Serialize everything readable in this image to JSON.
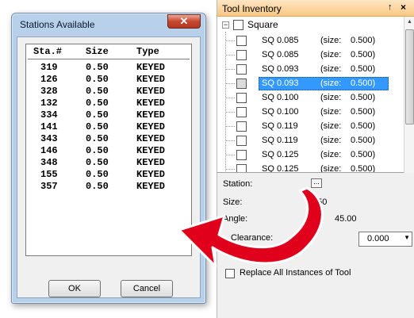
{
  "dialog": {
    "title": "Stations Available",
    "close_glyph": "✕",
    "columns": [
      "Sta.#",
      "Size",
      "Type"
    ],
    "rows": [
      {
        "station": "319",
        "size": "0.50",
        "type": "KEYED"
      },
      {
        "station": "126",
        "size": "0.50",
        "type": "KEYED"
      },
      {
        "station": "328",
        "size": "0.50",
        "type": "KEYED"
      },
      {
        "station": "132",
        "size": "0.50",
        "type": "KEYED"
      },
      {
        "station": "334",
        "size": "0.50",
        "type": "KEYED"
      },
      {
        "station": "141",
        "size": "0.50",
        "type": "KEYED"
      },
      {
        "station": "343",
        "size": "0.50",
        "type": "KEYED"
      },
      {
        "station": "146",
        "size": "0.50",
        "type": "KEYED"
      },
      {
        "station": "348",
        "size": "0.50",
        "type": "KEYED"
      },
      {
        "station": "155",
        "size": "0.50",
        "type": "KEYED"
      },
      {
        "station": "357",
        "size": "0.50",
        "type": "KEYED"
      }
    ],
    "ok_label": "OK",
    "cancel_label": "Cancel"
  },
  "panel": {
    "title": "Tool Inventory",
    "pin_glyph": "↑",
    "close_glyph": "×",
    "tree": {
      "expander_glyph": "−",
      "root_label": "Square",
      "tools": [
        {
          "name": "SQ 0.085",
          "size_label": "(size:",
          "size": "0.500)",
          "selected": false
        },
        {
          "name": "SQ 0.085",
          "size_label": "(size:",
          "size": "0.500)",
          "selected": false
        },
        {
          "name": "SQ 0.093",
          "size_label": "(size:",
          "size": "0.500)",
          "selected": false
        },
        {
          "name": "SQ 0.093",
          "size_label": "(size:",
          "size": "0.500)",
          "selected": true
        },
        {
          "name": "SQ 0.100",
          "size_label": "(size:",
          "size": "0.500)",
          "selected": false
        },
        {
          "name": "SQ 0.100",
          "size_label": "(size:",
          "size": "0.500)",
          "selected": false
        },
        {
          "name": "SQ 0.119",
          "size_label": "(size:",
          "size": "0.500)",
          "selected": false
        },
        {
          "name": "SQ 0.119",
          "size_label": "(size:",
          "size": "0.500)",
          "selected": false
        },
        {
          "name": "SQ 0.125",
          "size_label": "(size:",
          "size": "0.500)",
          "selected": false
        },
        {
          "name": "SQ 0.125",
          "size_label": "(size:",
          "size": "0.500)",
          "selected": false
        }
      ]
    },
    "station_label": "Station:",
    "browse_label": "...",
    "size_label": "Size:",
    "size_value": "0.50",
    "angle_label": "Angle:",
    "angle_value": "45.00",
    "clearance_label": "Clearance:",
    "clearance_value": "0.000",
    "combo_arrow_glyph": "▼",
    "replace_label": "Replace All Instances of Tool"
  },
  "colors": {
    "dialog_frame": "#b8d0ea",
    "panel_title": "#f9c781",
    "selection": "#3399ff",
    "arrow": "#e0001b"
  }
}
